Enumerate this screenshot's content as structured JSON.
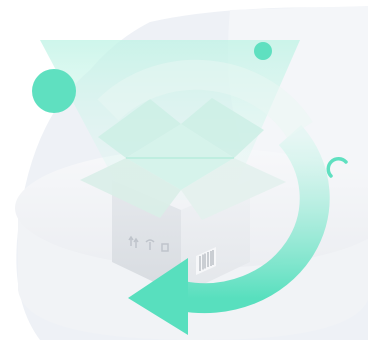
{
  "illustration": {
    "type": "empty-state",
    "icons": [
      "open-box-icon",
      "circular-arrow-icon",
      "package-fragile-symbols-icon",
      "barcode-icon"
    ],
    "colors": {
      "background": "#ffffff",
      "backdrop_blob": "#eef0f5",
      "accent": "#5fe0c0",
      "accent_light": "#c9f5e9",
      "box_gray": "#dfe3e8",
      "platform": "#f3f5f8"
    }
  }
}
